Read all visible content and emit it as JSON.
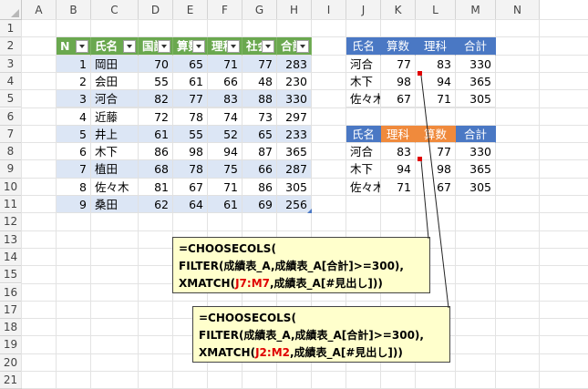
{
  "columns": [
    "A",
    "B",
    "C",
    "D",
    "E",
    "F",
    "G",
    "H",
    "I",
    "J",
    "K",
    "L",
    "M",
    "N"
  ],
  "rows": [
    "1",
    "2",
    "3",
    "4",
    "5",
    "6",
    "7",
    "8",
    "9",
    "10",
    "11",
    "12",
    "13",
    "14",
    "15",
    "16",
    "17",
    "18",
    "19",
    "20",
    "21"
  ],
  "table_a": {
    "headers": [
      "N",
      "氏名",
      "国語",
      "算数",
      "理科",
      "社会",
      "合計"
    ],
    "rows": [
      [
        "1",
        "岡田",
        "70",
        "65",
        "71",
        "77",
        "283"
      ],
      [
        "2",
        "会田",
        "55",
        "61",
        "66",
        "48",
        "230"
      ],
      [
        "3",
        "河合",
        "82",
        "77",
        "83",
        "88",
        "330"
      ],
      [
        "4",
        "近藤",
        "72",
        "78",
        "74",
        "73",
        "297"
      ],
      [
        "5",
        "井上",
        "61",
        "55",
        "52",
        "65",
        "233"
      ],
      [
        "6",
        "木下",
        "86",
        "98",
        "94",
        "87",
        "365"
      ],
      [
        "7",
        "植田",
        "68",
        "78",
        "75",
        "66",
        "287"
      ],
      [
        "8",
        "佐々木",
        "81",
        "67",
        "71",
        "86",
        "305"
      ],
      [
        "9",
        "桑田",
        "62",
        "64",
        "61",
        "69",
        "256"
      ]
    ]
  },
  "table_b": {
    "headers": [
      "氏名",
      "算数",
      "理科",
      "合計"
    ],
    "rows": [
      [
        "河合",
        "77",
        "83",
        "330"
      ],
      [
        "木下",
        "98",
        "94",
        "365"
      ],
      [
        "佐々木",
        "67",
        "71",
        "305"
      ]
    ]
  },
  "table_c": {
    "headers": [
      "氏名",
      "理科",
      "算数",
      "合計"
    ],
    "rows": [
      [
        "河合",
        "83",
        "77",
        "330"
      ],
      [
        "木下",
        "94",
        "98",
        "365"
      ],
      [
        "佐々木",
        "71",
        "67",
        "305"
      ]
    ]
  },
  "callout1": {
    "line1": "=CHOOSECOLS(",
    "line2": "FILTER(成績表_A,成績表_A[合計]>=300),",
    "line3_pre": "XMATCH(",
    "line3_ref": "J7:M7",
    "line3_post": ",成績表_A[#見出し]))"
  },
  "callout2": {
    "line1": "=CHOOSECOLS(",
    "line2": "FILTER(成績表_A,成績表_A[合計]>=300),",
    "line3_pre": "XMATCH(",
    "line3_ref": "J2:M2",
    "line3_post": ",成績表_A[#見出し]))"
  },
  "colors": {
    "green_header": "#6aa84f",
    "blue_row": "#dce6f5",
    "blue_header": "#4a78c4",
    "orange_header": "#f08a3c",
    "callout_bg": "#ffffcc",
    "ref_red": "#e00000"
  }
}
